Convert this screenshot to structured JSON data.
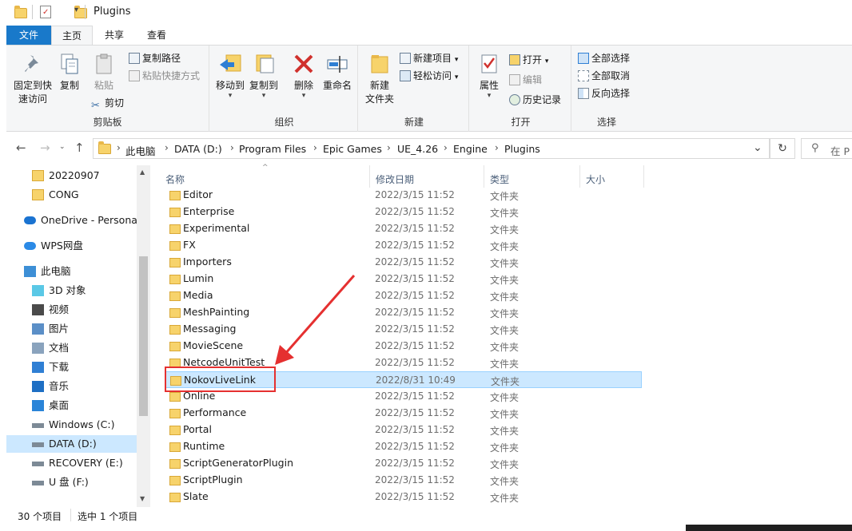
{
  "window": {
    "title": "Plugins"
  },
  "ribbon_tabs": [
    "文件",
    "主页",
    "共享",
    "查看"
  ],
  "ribbon": {
    "clipboard": {
      "pin_label": "固定到快速访问",
      "pin_label_1": "固定到快",
      "pin_label_2": "速访问",
      "copy_label": "复制",
      "paste_label": "粘贴",
      "copy_path_label": "复制路径",
      "paste_shortcut_label": "粘贴快捷方式",
      "cut_label": "剪切",
      "group_label": "剪贴板"
    },
    "organize": {
      "move_to_label": "移动到",
      "copy_to_label": "复制到",
      "delete_label": "删除",
      "rename_label": "重命名",
      "group_label": "组织"
    },
    "new": {
      "new_folder_label_1": "新建",
      "new_folder_label_2": "文件夹",
      "new_item_label": "新建项目",
      "easy_access_label": "轻松访问",
      "group_label": "新建"
    },
    "open": {
      "properties_label": "属性",
      "open_label": "打开",
      "edit_label": "编辑",
      "history_label": "历史记录",
      "group_label": "打开"
    },
    "select": {
      "select_all_label": "全部选择",
      "select_none_label": "全部取消",
      "invert_label": "反向选择",
      "group_label": "选择"
    }
  },
  "address": {
    "crumbs": [
      "此电脑",
      "DATA (D:)",
      "Program Files",
      "Epic Games",
      "UE_4.26",
      "Engine",
      "Plugins"
    ],
    "search_placeholder": "在 P"
  },
  "nav_pane": {
    "items": [
      {
        "label": "20220907",
        "icon": "folder-icon"
      },
      {
        "label": "CONG",
        "icon": "folder-icon"
      },
      {
        "label": "OneDrive - Personal",
        "icon": "onedrive-icon"
      },
      {
        "label": "WPS网盘",
        "icon": "wps-cloud-icon"
      },
      {
        "label": "此电脑",
        "icon": "this-pc-icon"
      },
      {
        "label": "3D 对象",
        "icon": "3d-objects-icon"
      },
      {
        "label": "视频",
        "icon": "videos-icon"
      },
      {
        "label": "图片",
        "icon": "pictures-icon"
      },
      {
        "label": "文档",
        "icon": "documents-icon"
      },
      {
        "label": "下载",
        "icon": "downloads-icon"
      },
      {
        "label": "音乐",
        "icon": "music-icon"
      },
      {
        "label": "桌面",
        "icon": "desktop-icon"
      },
      {
        "label": "Windows (C:)",
        "icon": "drive-icon"
      },
      {
        "label": "DATA (D:)",
        "icon": "drive-icon",
        "selected": true
      },
      {
        "label": "RECOVERY (E:)",
        "icon": "drive-icon"
      },
      {
        "label": "U 盘 (F:)",
        "icon": "usb-drive-icon"
      }
    ]
  },
  "file_list": {
    "columns": [
      "名称",
      "修改日期",
      "类型",
      "大小"
    ],
    "rows": [
      {
        "name": "Editor",
        "date": "2022/3/15 11:52",
        "type": "文件夹"
      },
      {
        "name": "Enterprise",
        "date": "2022/3/15 11:52",
        "type": "文件夹"
      },
      {
        "name": "Experimental",
        "date": "2022/3/15 11:52",
        "type": "文件夹"
      },
      {
        "name": "FX",
        "date": "2022/3/15 11:52",
        "type": "文件夹"
      },
      {
        "name": "Importers",
        "date": "2022/3/15 11:52",
        "type": "文件夹"
      },
      {
        "name": "Lumin",
        "date": "2022/3/15 11:52",
        "type": "文件夹"
      },
      {
        "name": "Media",
        "date": "2022/3/15 11:52",
        "type": "文件夹"
      },
      {
        "name": "MeshPainting",
        "date": "2022/3/15 11:52",
        "type": "文件夹"
      },
      {
        "name": "Messaging",
        "date": "2022/3/15 11:52",
        "type": "文件夹"
      },
      {
        "name": "MovieScene",
        "date": "2022/3/15 11:52",
        "type": "文件夹"
      },
      {
        "name": "NetcodeUnitTest",
        "date": "2022/3/15 11:52",
        "type": "文件夹"
      },
      {
        "name": "NokovLiveLink",
        "date": "2022/8/31 10:49",
        "type": "文件夹",
        "selected": true
      },
      {
        "name": "Online",
        "date": "2022/3/15 11:52",
        "type": "文件夹"
      },
      {
        "name": "Performance",
        "date": "2022/3/15 11:52",
        "type": "文件夹"
      },
      {
        "name": "Portal",
        "date": "2022/3/15 11:52",
        "type": "文件夹"
      },
      {
        "name": "Runtime",
        "date": "2022/3/15 11:52",
        "type": "文件夹"
      },
      {
        "name": "ScriptGeneratorPlugin",
        "date": "2022/3/15 11:52",
        "type": "文件夹"
      },
      {
        "name": "ScriptPlugin",
        "date": "2022/3/15 11:52",
        "type": "文件夹"
      },
      {
        "name": "Slate",
        "date": "2022/3/15 11:52",
        "type": "文件夹"
      }
    ]
  },
  "status": {
    "item_count": "30 个项目",
    "selected_count": "选中 1 个项目"
  },
  "colors": {
    "file_tab": "#1979ca",
    "selection": "#cce8ff",
    "annotation": "#e53030"
  }
}
